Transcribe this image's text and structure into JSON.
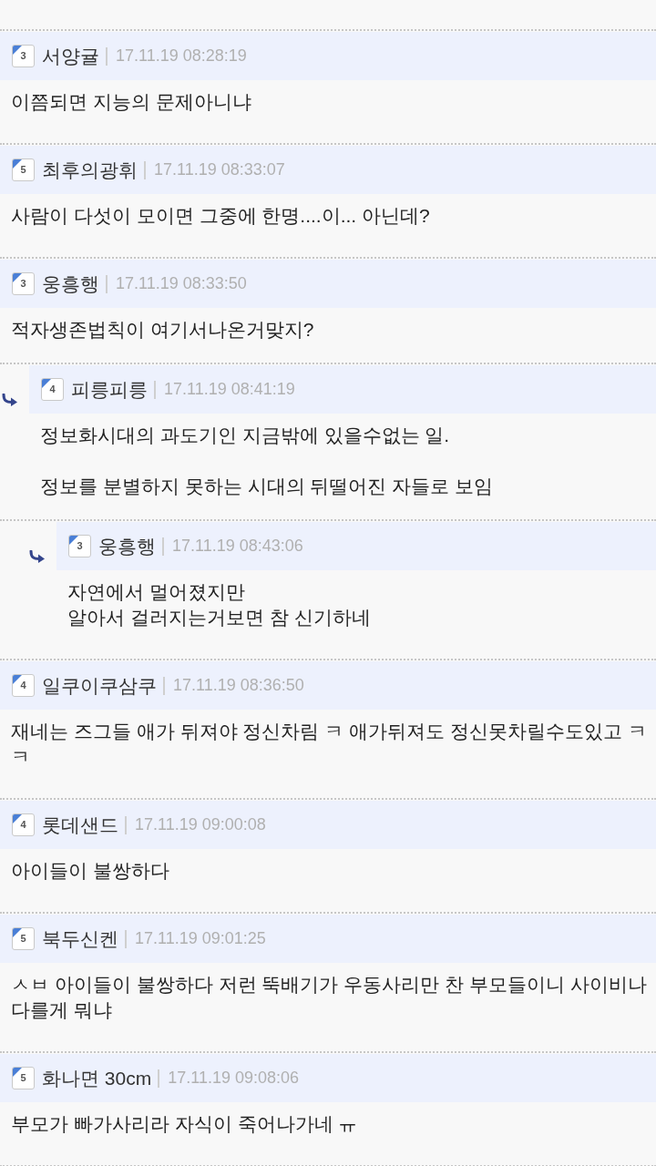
{
  "comments": [
    {
      "rank": "3",
      "author": "서양귤",
      "time": "17.11.19 08:28:19",
      "text": "이쯤되면 지능의 문제아니냐"
    },
    {
      "rank": "5",
      "author": "최후의광휘",
      "time": "17.11.19 08:33:07",
      "text": "사람이 다섯이 모이면 그중에 한명....이... 아닌데?"
    },
    {
      "rank": "3",
      "author": "웅흥행",
      "time": "17.11.19 08:33:50",
      "text": "적자생존법칙이 여기서나온거맞지?",
      "children": [
        {
          "rank": "4",
          "author": "피릉피릉",
          "time": "17.11.19 08:41:19",
          "text": "정보화시대의 과도기인 지금밖에 있을수없는 일.\n\n정보를 분별하지 못하는 시대의 뒤떨어진 자들로 보임",
          "children": [
            {
              "rank": "3",
              "author": "웅흥행",
              "time": "17.11.19 08:43:06",
              "text": "자연에서 멀어졌지만\n알아서 걸러지는거보면 참 신기하네"
            }
          ]
        }
      ]
    },
    {
      "rank": "4",
      "author": "일쿠이쿠삼쿠",
      "time": "17.11.19 08:36:50",
      "text": "재네는 즈그들 애가 뒤져야 정신차림 ㅋ 애가뒤져도 정신못차릴수도있고 ㅋㅋ"
    },
    {
      "rank": "4",
      "author": "롯데샌드",
      "time": "17.11.19 09:00:08",
      "text": "아이들이 불쌍하다"
    },
    {
      "rank": "5",
      "author": "북두신켄",
      "time": "17.11.19 09:01:25",
      "text": "ㅅㅂ 아이들이 불쌍하다 저런 뚝배기가 우동사리만 찬 부모들이니 사이비나 다를게 뭐냐"
    },
    {
      "rank": "5",
      "author": "화나면 30cm",
      "time": "17.11.19 09:08:06",
      "text": "부모가 빠가사리라 자식이 죽어나가네 ㅠ"
    }
  ]
}
